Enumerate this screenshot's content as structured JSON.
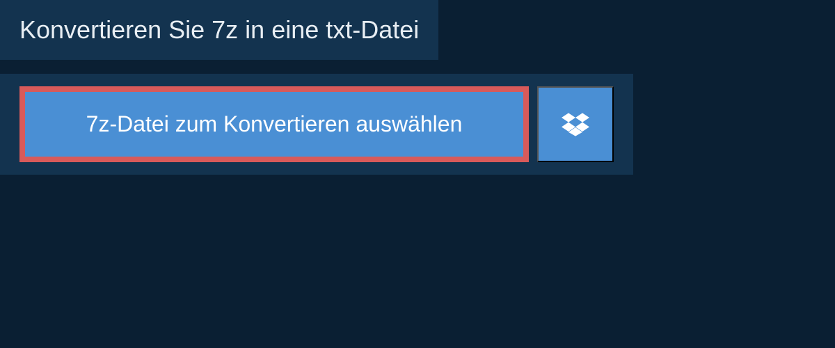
{
  "header": {
    "title": "Konvertieren Sie 7z in eine txt-Datei"
  },
  "actions": {
    "select_file_label": "7z-Datei zum Konvertieren auswählen",
    "dropbox_icon": "dropbox"
  },
  "colors": {
    "background": "#0a1f33",
    "panel": "#13334f",
    "button": "#4a8fd4",
    "highlight_border": "#d85a5a",
    "text_light": "#e8eef3",
    "text_white": "#ffffff"
  }
}
